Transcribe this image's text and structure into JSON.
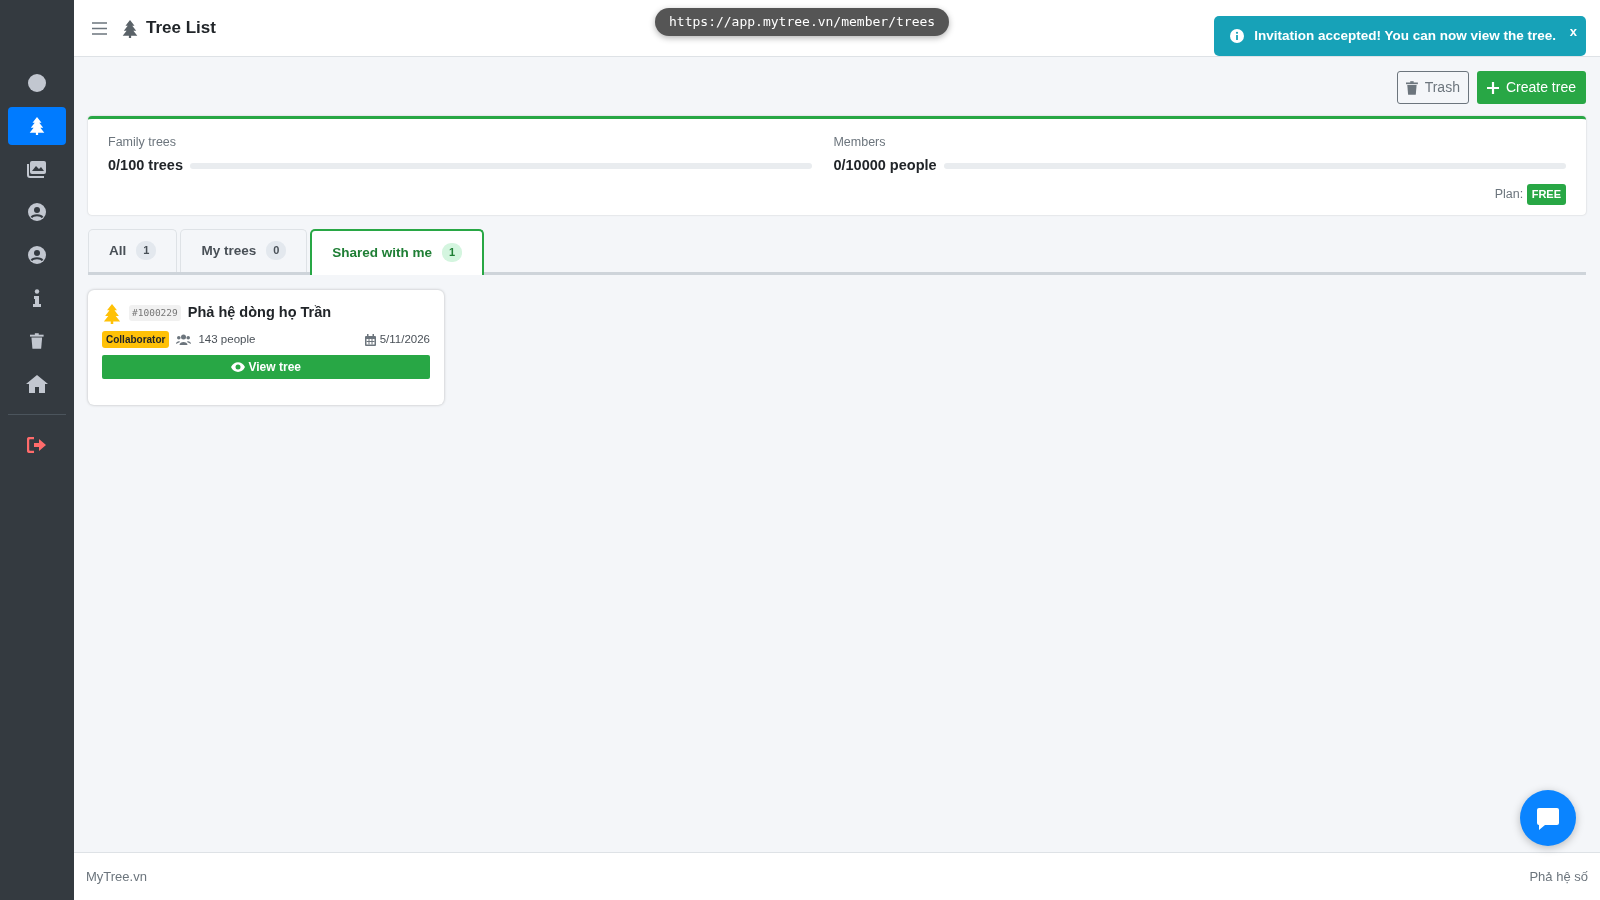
{
  "sidebar": {
    "items": [
      {
        "kind": "avatar",
        "selected": false
      },
      {
        "kind": "tree",
        "selected": true
      },
      {
        "kind": "images",
        "selected": false
      },
      {
        "kind": "user",
        "selected": false
      },
      {
        "kind": "user",
        "selected": false
      },
      {
        "kind": "info",
        "selected": false
      },
      {
        "kind": "trash",
        "selected": false
      },
      {
        "kind": "home",
        "selected": false
      },
      {
        "kind": "logout",
        "selected": false
      }
    ]
  },
  "header": {
    "title": "Tree List"
  },
  "url_pill": "https://app.mytree.vn/member/trees",
  "toast": {
    "message": "Invitation accepted! You can now view the tree.",
    "close": "x"
  },
  "actions": [
    {
      "kind": "trash",
      "label": "Trash"
    },
    {
      "kind": "create",
      "label": "Create tree"
    }
  ],
  "quota": {
    "items": [
      {
        "label": "Family trees",
        "value": "0/100 trees",
        "level": 0
      },
      {
        "label": "Members",
        "value": "0/10000 people",
        "level": 0
      }
    ],
    "plan_label": "Plan:",
    "plan": "FREE"
  },
  "tabs": [
    {
      "label": "All",
      "count": "1",
      "selected": false
    },
    {
      "label": "My trees",
      "count": "0",
      "selected": false
    },
    {
      "label": "Shared with me",
      "count": "1",
      "selected": true
    }
  ],
  "trees": [
    {
      "id": "#1000229",
      "name": "Phả hệ dòng họ Trần",
      "role": "Collaborator",
      "people": "143 people",
      "date": "5/11/2026",
      "button": "View tree"
    }
  ],
  "footer": {
    "left": "MyTree.vn",
    "right": "Phả hệ số"
  }
}
